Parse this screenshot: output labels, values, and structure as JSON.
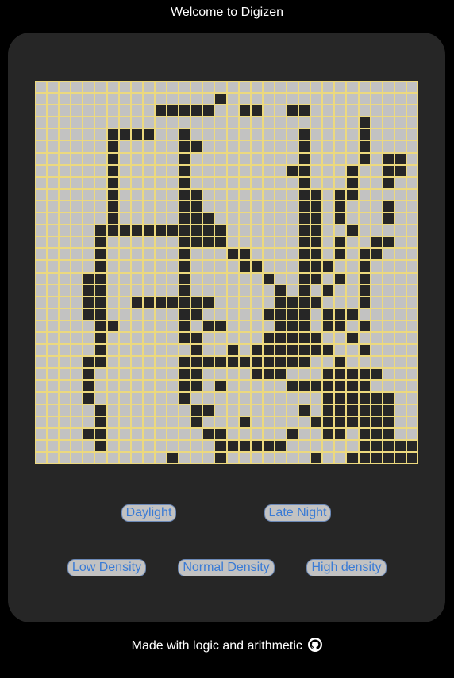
{
  "header": {
    "title": "Welcome to Digizen"
  },
  "theme_buttons": {
    "daylight": "Daylight",
    "late_night": "Late Night"
  },
  "density_buttons": {
    "low": "Low Density",
    "normal": "Normal Density",
    "high": "High density"
  },
  "footer": {
    "text": "Made with logic and arithmetic",
    "icon": "github-icon"
  },
  "colors": {
    "live_cell": "#262626",
    "dead_cell": "#c2c2c2",
    "grid_line": "#ecd97e",
    "panel": "#262626",
    "button_text": "#3a7bd5"
  },
  "grid": {
    "cols": 32,
    "rows": 32,
    "live_rows": [
      "................................",
      "...............#................",
      "..........#####..##..##.........",
      "...........................#....",
      "......####..#.........#....#....",
      "......#.....##........#....#....",
      "......#.....#.........#....#.##.",
      "......#.....#........##...#..##.",
      "......#.....#.........#...#..#..",
      "......#.....##........##.##.....",
      "......#.....##........##.#...#..",
      "......#.....###.......##.#...#..",
      ".....###########......##..#.....",
      ".....#......####......##.#..##..",
      ".....#......#...##....##.#.##...",
      ".....#......#....##...###..#....",
      "....##......#......#..##.#.#....",
      "....##......#.......#.#.#..#....",
      "....##..#######.....####...#....",
      "....##......##.....####.###.....",
      ".....##.....#.##....###.##.#....",
      ".....#......##.....#####..#.....",
      ".....#.......#..#.#######..#....",
      "....##......###########..#......",
      "....#.......##....###...#####...",
      "....#.......##.#.....#######....",
      "....#.......#...........######..",
      ".....#.......##.......#.######..",
      ".....#.......#...#.....#######..",
      "....##........##.....#..##.###..",
      ".....#.........######......######",
      "...........#...#.......#..######"
    ]
  }
}
